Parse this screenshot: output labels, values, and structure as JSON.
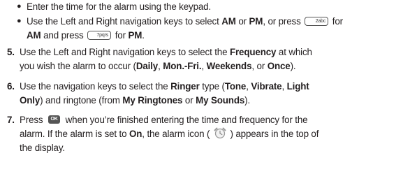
{
  "bullets": [
    {
      "pre": "Enter the time for the alarm using the keypad."
    },
    {
      "line1_pre": "Use the Left and Right navigation keys to select ",
      "am": "AM",
      "or1": " or ",
      "pm": "PM",
      "line1_mid": ", or press ",
      "key1": "2abc",
      "line1_for": " for",
      "line2_am": "AM",
      "line2_and": " and press ",
      "key2": "7pqrs",
      "line2_for": " for ",
      "line2_pm": "PM",
      "line2_end": "."
    }
  ],
  "steps": [
    {
      "num": "5.",
      "l1_pre": "Use the Left and Right navigation keys to select the ",
      "l1_bold": "Frequency",
      "l1_post": " at which",
      "l2_pre": "you wish the alarm to occur (",
      "o1": "Daily",
      "c1": ", ",
      "o2": "Mon.-Fri.",
      "c2": ", ",
      "o3": "Weekends",
      "c3": ", or ",
      "o4": "Once",
      "end": ")."
    },
    {
      "num": "6.",
      "l1_pre": "Use the navigation keys to select the ",
      "ringer": "Ringer",
      "l1_mid": " type (",
      "tone": "Tone",
      "c1": ", ",
      "vibrate": "Vibrate",
      "c2": ", ",
      "light": "Light",
      "only": "Only",
      "l2_mid": ") and ringtone (from ",
      "myr": "My Ringtones",
      "or": " or ",
      "mys": "My Sounds",
      "end": ")."
    },
    {
      "num": "7.",
      "l1_pre": "Press ",
      "ok": "OK",
      "l1_post": " when you’re finished entering the time and frequency for the",
      "l2_pre": "alarm. If the alarm is set to ",
      "on": "On",
      "l2_mid": ", the alarm icon ( ",
      "l2_post": " ) appears in the top of",
      "l3": "the display."
    }
  ],
  "icons": {
    "alarm": "alarm-clock-icon"
  },
  "colors": {
    "text": "#231f20",
    "key_border": "#555555",
    "ok_bg": "#555555"
  }
}
